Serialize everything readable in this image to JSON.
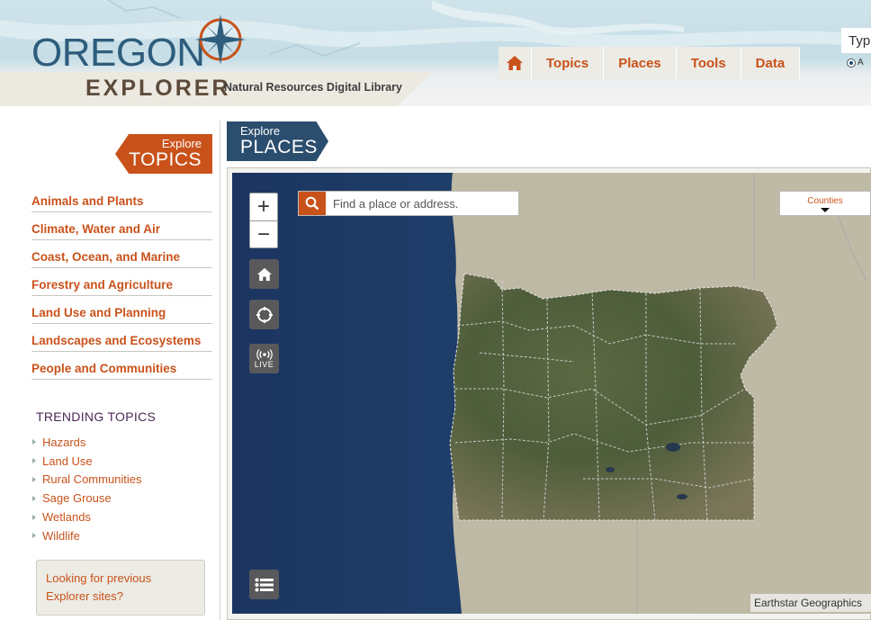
{
  "header": {
    "logo_main": "OREGON",
    "logo_sub_main": "EXPLORER",
    "logo_tagline": "Natural Resources Digital Library",
    "nav": [
      {
        "label": "Topics"
      },
      {
        "label": "Places"
      },
      {
        "label": "Tools"
      },
      {
        "label": "Data"
      }
    ],
    "search_text": "Typ",
    "radio_label": "A"
  },
  "sidebar": {
    "banner_small": "Explore",
    "banner_big": "TOPICS",
    "topics": [
      {
        "label": "Animals and Plants"
      },
      {
        "label": "Climate, Water and Air"
      },
      {
        "label": "Coast, Ocean, and Marine"
      },
      {
        "label": "Forestry and Agriculture"
      },
      {
        "label": "Land Use and Planning"
      },
      {
        "label": "Landscapes and Ecosystems"
      },
      {
        "label": "People and Communities"
      }
    ],
    "trending_title": "TRENDING TOPICS",
    "trending": [
      {
        "label": "Hazards"
      },
      {
        "label": "Land Use"
      },
      {
        "label": "Rural Communities"
      },
      {
        "label": "Sage Grouse"
      },
      {
        "label": "Wetlands"
      },
      {
        "label": "Wildlife"
      }
    ],
    "previous_sites": "Looking for previous Explorer sites?"
  },
  "places": {
    "banner_small": "Explore",
    "banner_big": "PLACES",
    "search_placeholder": "Find a place or address.",
    "layer_label": "Counties",
    "live_label": "LIVE",
    "attribution": "Earthstar Geographics"
  },
  "colors": {
    "accent": "#c9521b",
    "navy": "#2b4d6e",
    "ocean": "#1c3a63"
  }
}
